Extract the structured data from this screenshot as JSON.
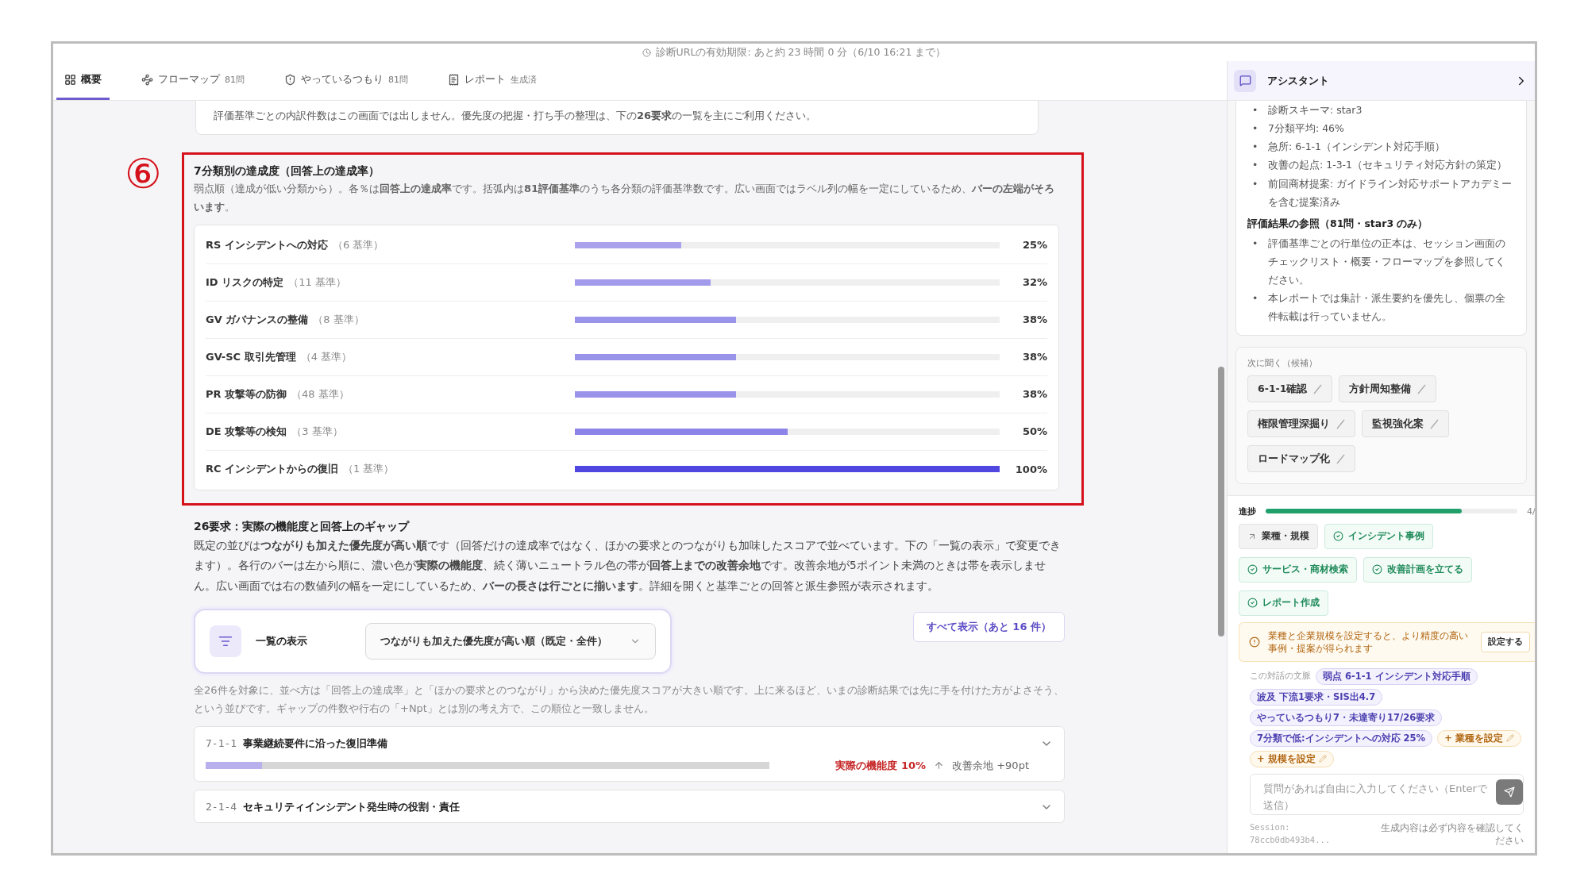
{
  "expiry_notice": "診断URLの有効期限: あと約 23 時間 0 分（6/10 16:21 まで）",
  "tabs": [
    {
      "label": "概要",
      "selected": true
    },
    {
      "label": "フローマップ",
      "badge": "81問",
      "selected": false
    },
    {
      "label": "やっているつもり",
      "badge": "81問",
      "selected": false
    },
    {
      "label": "レポート",
      "badge": "生成済",
      "selected": false
    }
  ],
  "intro_note": "評価基準ごとの内訳件数はこの画面では出しません。優先度の把握・打ち手の整理は、下の**26要求**の一覧を主にご利用ください。",
  "annotation": {
    "marker": "⑥"
  },
  "category_section": {
    "title": "7分類別の達成度（回答上の達成率）",
    "description": "弱点順（達成が低い分類から）。各％は**回答上の達成率**です。括弧内は**81評価基準**のうち各分類の評価基準数です。広い画面ではラベル列の幅を一定にしているため、**バーの左端がそろいます**。",
    "rows": [
      {
        "label": "RS インシデントへの対応",
        "count": "（6 基準）",
        "level": 0.25,
        "percent": "25%"
      },
      {
        "label": "ID リスクの特定",
        "count": "（11 基準）",
        "level": 0.32,
        "percent": "32%"
      },
      {
        "label": "GV ガバナンスの整備",
        "count": "（8 基準）",
        "level": 0.38,
        "percent": "38%"
      },
      {
        "label": "GV-SC 取引先管理",
        "count": "（4 基準）",
        "level": 0.38,
        "percent": "38%"
      },
      {
        "label": "PR 攻撃等の防御",
        "count": "（48 基準）",
        "level": 0.38,
        "percent": "38%"
      },
      {
        "label": "DE 攻撃等の検知",
        "count": "（3 基準）",
        "level": 0.5,
        "percent": "50%"
      },
      {
        "label": "RC インシデントからの復旧",
        "count": "（1 基準）",
        "level": 1,
        "percent": "100%"
      }
    ]
  },
  "requirements_section": {
    "title": "26要求：実際の機能度と回答上のギャップ",
    "description": "既定の並びは**つながりも加えた優先度が高い順**です（回答だけの達成率ではなく、ほかの要求とのつながりも加味したスコアで並べています。下の「一覧の表示」で変更できます）。各行のバーは左から順に、濃い色が**実際の機能度**、続く薄いニュートラル色の帯が**回答上までの改善余地**です。改善余地が5ポイント未満のときは帯を表示しません。広い画面では右の数値列の幅を一定にしているため、**バーの長さは行ごとに揃います**。詳細を開くと基準ごとの回答と派生参照が表示されます。",
    "view_control": {
      "label": "一覧の表示",
      "select_value": "つながりも加えた優先度が高い順（既定・全件）"
    },
    "show_all_button": "すべて表示（あと 16 件）",
    "note": "全26件を対象に、並べ方は「回答上の達成率」と「ほかの要求とのつながり」から決めた優先度スコアが大きい順です。上に来るほど、いまの診断結果では先に手を付けた方がよさそう、という並びです。ギャップの件数や行右の「+Npt」とは別の考え方で、この順位と一致しません。",
    "items": [
      {
        "code": "7-1-1",
        "title": "事業継続要件に沿った復旧準備",
        "expanded": false,
        "level": 0.1,
        "actual_text": "実際の機能度 10%",
        "gap_text": "改善余地 +90pt"
      },
      {
        "code": "2-1-4",
        "title": "セキュリティインシデント発生時の役割・責任",
        "expanded": false
      }
    ]
  },
  "assistant": {
    "title": "アシスタント",
    "summary_items": [
      {
        "marker": "•",
        "text": "診断スキーマ: star3"
      },
      {
        "marker": "•",
        "text": "7分類平均: 46%"
      },
      {
        "marker": "•",
        "text": "急所: 6-1-1（インシデント対応手順）"
      },
      {
        "marker": "•",
        "text": "改善の起点: 1-3-1（セキュリティ対応方針の策定）"
      },
      {
        "marker": "•",
        "text": "前回商材提案: ガイドライン対応サポートアカデミーを含む提案済み"
      }
    ],
    "reference_heading": "評価結果の参照（81問・star3 のみ）",
    "reference_items": [
      {
        "marker": "•",
        "text": "評価基準ごとの行単位の正本は、セッション画面のチェックリスト・概要・フローマップを参照してください。"
      },
      {
        "marker": "•",
        "text": "本レポートでは集計・派生要約を優先し、個票の全件転載は行っていません。"
      }
    ],
    "suggestions": {
      "label": "次に聞く（候補）",
      "items": [
        "6-1-1確認",
        "方針周知整備",
        "権限管理深掘り",
        "監視強化案",
        "ロードマップ化"
      ]
    },
    "progress": {
      "label": "進捗",
      "level": 0.78,
      "count": "4/",
      "steps": [
        {
          "label": "業種・規模",
          "done": false
        },
        {
          "label": "インシデント事例",
          "done": true
        },
        {
          "label": "サービス・商材検索",
          "done": true
        },
        {
          "label": "改善計画を立てる",
          "done": true
        },
        {
          "label": "レポート作成",
          "done": true
        }
      ]
    },
    "warning": {
      "text": "業種と企業規模を設定すると、より精度の高い事例・提案が得られます",
      "button": "設定する"
    },
    "context": {
      "label": "この対話の文脈",
      "tags": [
        {
          "text": "弱点 6-1-1 インシデント対応手順",
          "kind": "context"
        },
        {
          "text": "波及 下流1要求・SIS出4.7",
          "kind": "context"
        },
        {
          "text": "やっているつもり7・未達寄り17/26要求",
          "kind": "context"
        },
        {
          "text": "7分類で低:インシデントへの対応 25%",
          "kind": "context"
        },
        {
          "text": "+ 業種を設定",
          "kind": "setting"
        },
        {
          "text": "+ 規模を設定",
          "kind": "setting"
        }
      ]
    },
    "input": {
      "placeholder": "質問があれば自由に入力してください（Enterで送信）"
    },
    "footer": {
      "session_label": "Session:",
      "session_id": "78ccb0db493b4...",
      "disclaimer": "生成内容は必ず内容を確認してください"
    }
  }
}
